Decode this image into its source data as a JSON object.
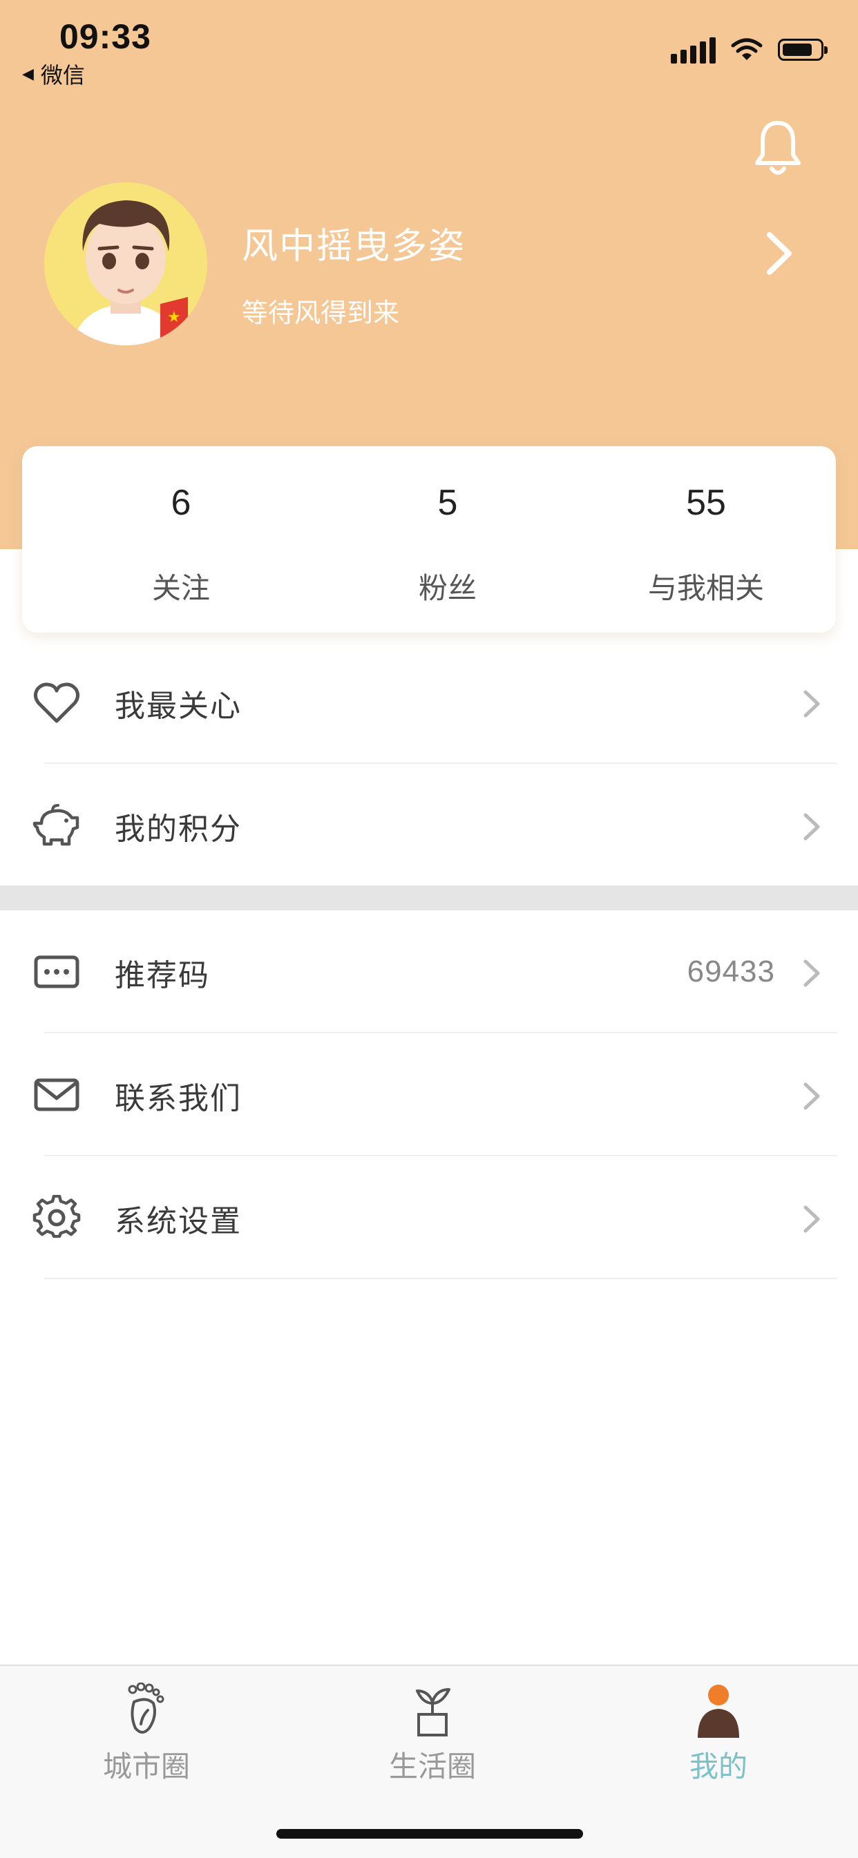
{
  "status_bar": {
    "time": "09:33",
    "back_label": "微信",
    "icons": [
      "signal-icon",
      "wifi-icon",
      "battery-icon"
    ]
  },
  "header": {
    "bell_icon": "bell-icon",
    "username": "风中摇曳多姿",
    "signature": "等待风得到来",
    "arrow_icon": "chevron-right-icon",
    "bg_color": "#f4c795"
  },
  "stats": [
    {
      "count": "6",
      "label": "关注"
    },
    {
      "count": "5",
      "label": "粉丝"
    },
    {
      "count": "55",
      "label": "与我相关"
    }
  ],
  "menu": [
    {
      "icon": "heart-icon",
      "label": "我最关心",
      "value": ""
    },
    {
      "icon": "piggy-bank-icon",
      "label": "我的积分",
      "value": ""
    },
    {
      "icon": "more-dots-icon",
      "label": "推荐码",
      "value": "69433"
    },
    {
      "icon": "mail-icon",
      "label": "联系我们",
      "value": ""
    },
    {
      "icon": "gear-icon",
      "label": "系统设置",
      "value": ""
    }
  ],
  "tabbar": {
    "active_color": "#7ac2c7",
    "items": [
      {
        "icon": "footprint-icon",
        "label": "城市圈",
        "active": false
      },
      {
        "icon": "plant-pot-icon",
        "label": "生活圈",
        "active": false
      },
      {
        "icon": "person-icon",
        "label": "我的",
        "active": true
      }
    ]
  }
}
